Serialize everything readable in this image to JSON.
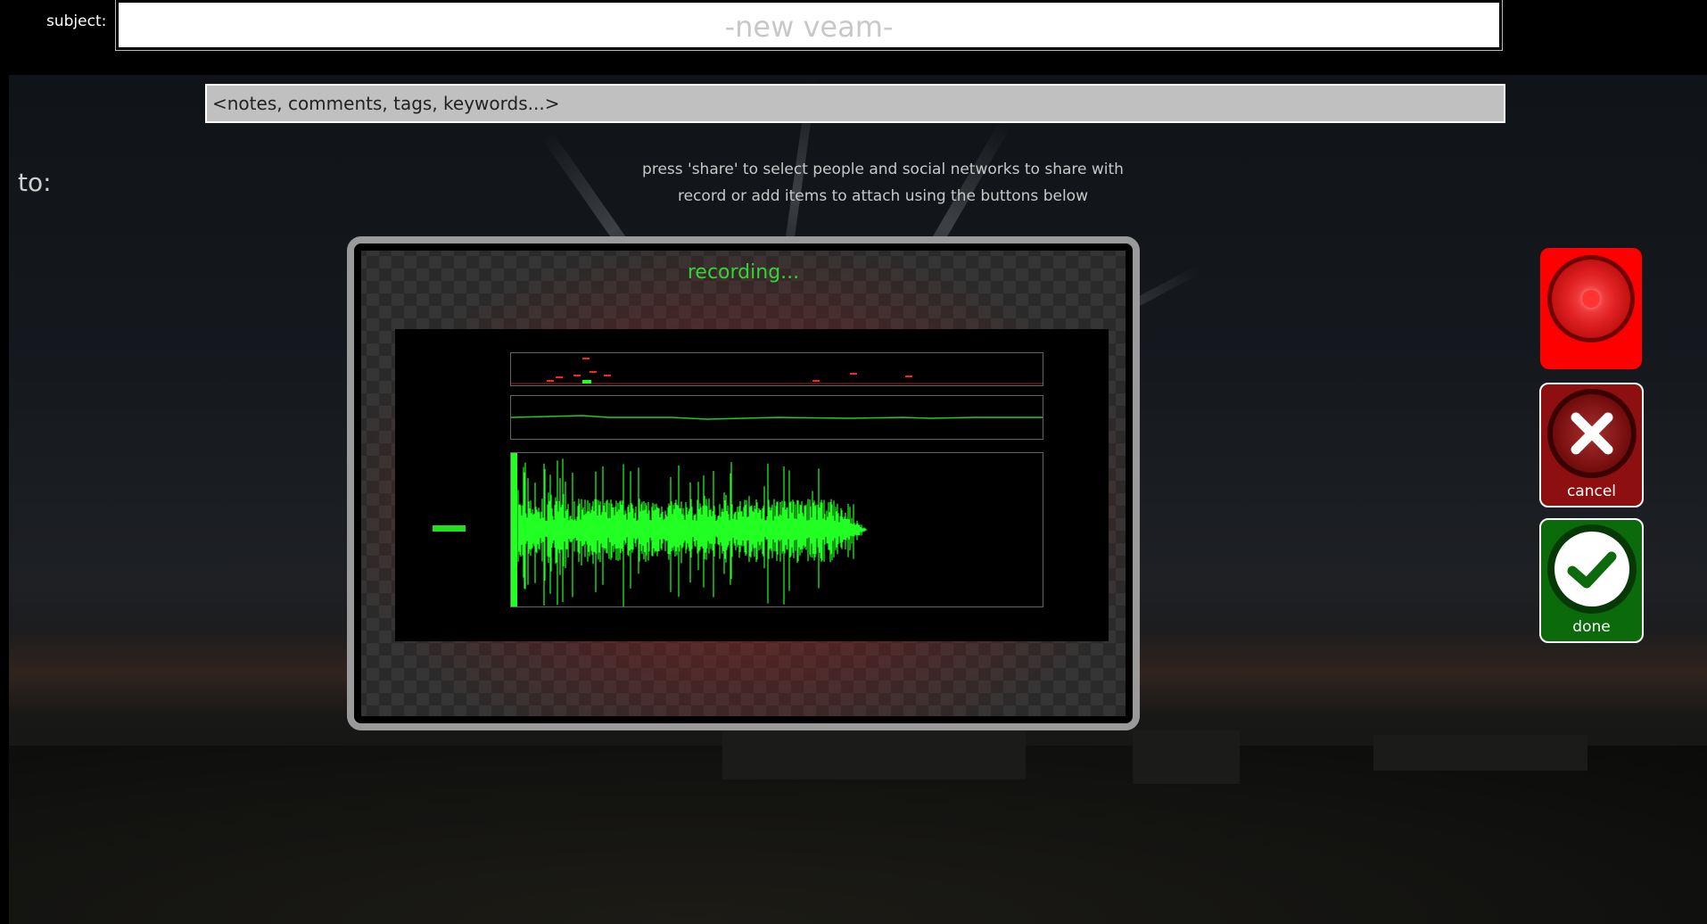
{
  "subject": {
    "label": "subject:",
    "placeholder": "-new veam-"
  },
  "notes": {
    "placeholder": "<notes, comments, tags, keywords...>"
  },
  "to_label": "to:",
  "hints": {
    "line1": "press 'share' to select people and social networks to share with",
    "line2": "record or add items to attach using the buttons below"
  },
  "recorder": {
    "status": "recording..."
  },
  "buttons": {
    "record": {
      "label": ""
    },
    "cancel": {
      "label": "cancel"
    },
    "done": {
      "label": "done"
    }
  },
  "colors": {
    "accent_green": "#35d435",
    "waveform": "#22ff22",
    "record_red": "#ff0000",
    "cancel_red": "#8e0f0f",
    "done_green": "#0b6b0b"
  },
  "icons": [
    "record-icon",
    "close-icon",
    "checkmark-icon"
  ]
}
